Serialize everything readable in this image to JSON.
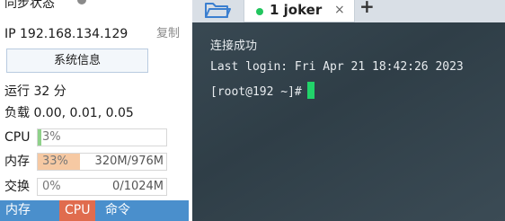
{
  "monitor": {
    "sync_status_label": "同步状态",
    "ip_text": "IP 192.168.134.129",
    "copy_label": "复制",
    "sysinfo_button_label": "系统信息",
    "uptime_text": "运行 32 分",
    "load_text": "负载 0.00, 0.01, 0.05",
    "cpu": {
      "label": "CPU",
      "percent_text": "3%",
      "percent": 3
    },
    "memory": {
      "label": "内存",
      "percent_text": "33%",
      "percent": 33,
      "amount": "320M/976M"
    },
    "swap": {
      "label": "交换",
      "percent_text": "0%",
      "percent": 0,
      "amount": "0/1024M"
    },
    "bottom_tabs": [
      "内存",
      "CPU",
      "命令"
    ],
    "colors": {
      "memory_fill": "#f6c9a3",
      "cpu_fill": "#8fd18a",
      "tab_bar": "#4a8fcc",
      "cpu_tab": "#e06c4e"
    }
  },
  "terminal": {
    "folder_icon": "folder-icon",
    "session_tab_label": "1 joker",
    "close_label": "×",
    "new_tab_label": "+",
    "lines": [
      "连接成功",
      "Last login: Fri Apr 21 18:42:26 2023",
      "[root@192 ~]#"
    ],
    "colors": {
      "status_dot": "#22c55e",
      "cursor": "#22d36a"
    }
  }
}
